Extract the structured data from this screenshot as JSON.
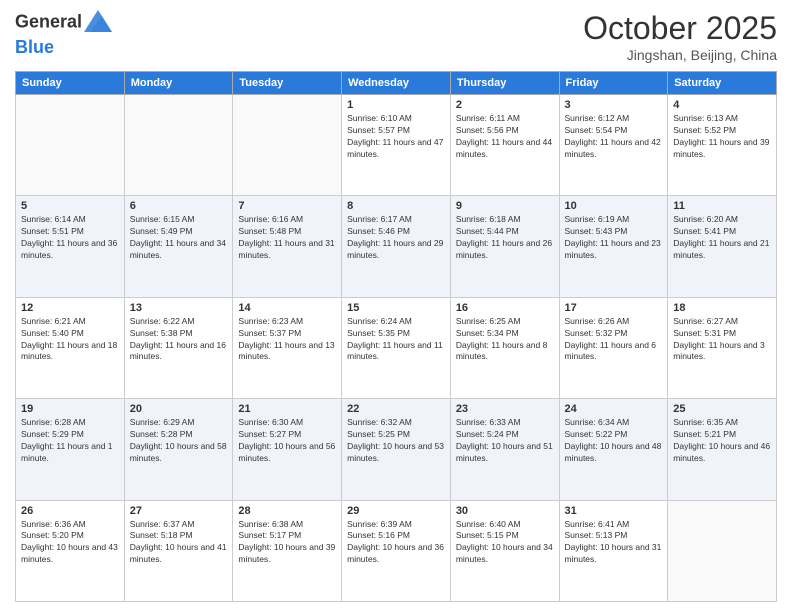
{
  "header": {
    "logo_general": "General",
    "logo_blue": "Blue",
    "month": "October 2025",
    "location": "Jingshan, Beijing, China"
  },
  "days_of_week": [
    "Sunday",
    "Monday",
    "Tuesday",
    "Wednesday",
    "Thursday",
    "Friday",
    "Saturday"
  ],
  "weeks": [
    [
      {
        "day": "",
        "sunrise": "",
        "sunset": "",
        "daylight": ""
      },
      {
        "day": "",
        "sunrise": "",
        "sunset": "",
        "daylight": ""
      },
      {
        "day": "",
        "sunrise": "",
        "sunset": "",
        "daylight": ""
      },
      {
        "day": "1",
        "sunrise": "Sunrise: 6:10 AM",
        "sunset": "Sunset: 5:57 PM",
        "daylight": "Daylight: 11 hours and 47 minutes."
      },
      {
        "day": "2",
        "sunrise": "Sunrise: 6:11 AM",
        "sunset": "Sunset: 5:56 PM",
        "daylight": "Daylight: 11 hours and 44 minutes."
      },
      {
        "day": "3",
        "sunrise": "Sunrise: 6:12 AM",
        "sunset": "Sunset: 5:54 PM",
        "daylight": "Daylight: 11 hours and 42 minutes."
      },
      {
        "day": "4",
        "sunrise": "Sunrise: 6:13 AM",
        "sunset": "Sunset: 5:52 PM",
        "daylight": "Daylight: 11 hours and 39 minutes."
      }
    ],
    [
      {
        "day": "5",
        "sunrise": "Sunrise: 6:14 AM",
        "sunset": "Sunset: 5:51 PM",
        "daylight": "Daylight: 11 hours and 36 minutes."
      },
      {
        "day": "6",
        "sunrise": "Sunrise: 6:15 AM",
        "sunset": "Sunset: 5:49 PM",
        "daylight": "Daylight: 11 hours and 34 minutes."
      },
      {
        "day": "7",
        "sunrise": "Sunrise: 6:16 AM",
        "sunset": "Sunset: 5:48 PM",
        "daylight": "Daylight: 11 hours and 31 minutes."
      },
      {
        "day": "8",
        "sunrise": "Sunrise: 6:17 AM",
        "sunset": "Sunset: 5:46 PM",
        "daylight": "Daylight: 11 hours and 29 minutes."
      },
      {
        "day": "9",
        "sunrise": "Sunrise: 6:18 AM",
        "sunset": "Sunset: 5:44 PM",
        "daylight": "Daylight: 11 hours and 26 minutes."
      },
      {
        "day": "10",
        "sunrise": "Sunrise: 6:19 AM",
        "sunset": "Sunset: 5:43 PM",
        "daylight": "Daylight: 11 hours and 23 minutes."
      },
      {
        "day": "11",
        "sunrise": "Sunrise: 6:20 AM",
        "sunset": "Sunset: 5:41 PM",
        "daylight": "Daylight: 11 hours and 21 minutes."
      }
    ],
    [
      {
        "day": "12",
        "sunrise": "Sunrise: 6:21 AM",
        "sunset": "Sunset: 5:40 PM",
        "daylight": "Daylight: 11 hours and 18 minutes."
      },
      {
        "day": "13",
        "sunrise": "Sunrise: 6:22 AM",
        "sunset": "Sunset: 5:38 PM",
        "daylight": "Daylight: 11 hours and 16 minutes."
      },
      {
        "day": "14",
        "sunrise": "Sunrise: 6:23 AM",
        "sunset": "Sunset: 5:37 PM",
        "daylight": "Daylight: 11 hours and 13 minutes."
      },
      {
        "day": "15",
        "sunrise": "Sunrise: 6:24 AM",
        "sunset": "Sunset: 5:35 PM",
        "daylight": "Daylight: 11 hours and 11 minutes."
      },
      {
        "day": "16",
        "sunrise": "Sunrise: 6:25 AM",
        "sunset": "Sunset: 5:34 PM",
        "daylight": "Daylight: 11 hours and 8 minutes."
      },
      {
        "day": "17",
        "sunrise": "Sunrise: 6:26 AM",
        "sunset": "Sunset: 5:32 PM",
        "daylight": "Daylight: 11 hours and 6 minutes."
      },
      {
        "day": "18",
        "sunrise": "Sunrise: 6:27 AM",
        "sunset": "Sunset: 5:31 PM",
        "daylight": "Daylight: 11 hours and 3 minutes."
      }
    ],
    [
      {
        "day": "19",
        "sunrise": "Sunrise: 6:28 AM",
        "sunset": "Sunset: 5:29 PM",
        "daylight": "Daylight: 11 hours and 1 minute."
      },
      {
        "day": "20",
        "sunrise": "Sunrise: 6:29 AM",
        "sunset": "Sunset: 5:28 PM",
        "daylight": "Daylight: 10 hours and 58 minutes."
      },
      {
        "day": "21",
        "sunrise": "Sunrise: 6:30 AM",
        "sunset": "Sunset: 5:27 PM",
        "daylight": "Daylight: 10 hours and 56 minutes."
      },
      {
        "day": "22",
        "sunrise": "Sunrise: 6:32 AM",
        "sunset": "Sunset: 5:25 PM",
        "daylight": "Daylight: 10 hours and 53 minutes."
      },
      {
        "day": "23",
        "sunrise": "Sunrise: 6:33 AM",
        "sunset": "Sunset: 5:24 PM",
        "daylight": "Daylight: 10 hours and 51 minutes."
      },
      {
        "day": "24",
        "sunrise": "Sunrise: 6:34 AM",
        "sunset": "Sunset: 5:22 PM",
        "daylight": "Daylight: 10 hours and 48 minutes."
      },
      {
        "day": "25",
        "sunrise": "Sunrise: 6:35 AM",
        "sunset": "Sunset: 5:21 PM",
        "daylight": "Daylight: 10 hours and 46 minutes."
      }
    ],
    [
      {
        "day": "26",
        "sunrise": "Sunrise: 6:36 AM",
        "sunset": "Sunset: 5:20 PM",
        "daylight": "Daylight: 10 hours and 43 minutes."
      },
      {
        "day": "27",
        "sunrise": "Sunrise: 6:37 AM",
        "sunset": "Sunset: 5:18 PM",
        "daylight": "Daylight: 10 hours and 41 minutes."
      },
      {
        "day": "28",
        "sunrise": "Sunrise: 6:38 AM",
        "sunset": "Sunset: 5:17 PM",
        "daylight": "Daylight: 10 hours and 39 minutes."
      },
      {
        "day": "29",
        "sunrise": "Sunrise: 6:39 AM",
        "sunset": "Sunset: 5:16 PM",
        "daylight": "Daylight: 10 hours and 36 minutes."
      },
      {
        "day": "30",
        "sunrise": "Sunrise: 6:40 AM",
        "sunset": "Sunset: 5:15 PM",
        "daylight": "Daylight: 10 hours and 34 minutes."
      },
      {
        "day": "31",
        "sunrise": "Sunrise: 6:41 AM",
        "sunset": "Sunset: 5:13 PM",
        "daylight": "Daylight: 10 hours and 31 minutes."
      },
      {
        "day": "",
        "sunrise": "",
        "sunset": "",
        "daylight": ""
      }
    ]
  ]
}
